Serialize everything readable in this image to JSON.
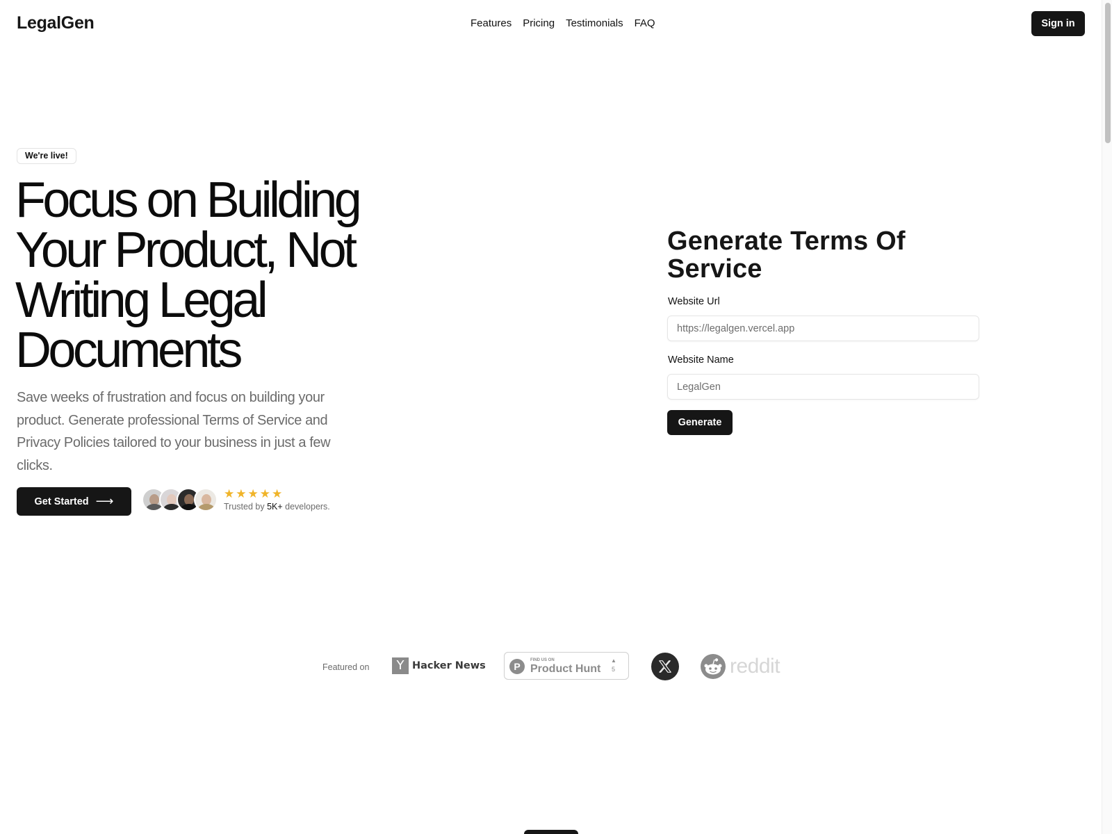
{
  "header": {
    "logo": "LegalGen",
    "nav": [
      {
        "label": "Features"
      },
      {
        "label": "Pricing"
      },
      {
        "label": "Testimonials"
      },
      {
        "label": "FAQ"
      }
    ],
    "sign_in_label": "Sign in"
  },
  "hero": {
    "badge": "We're live!",
    "headline": "Focus on Building Your Product, Not Writing Legal Documents",
    "subheadline": "Save weeks of frustration and focus on building your product. Generate professional Terms of Service and Privacy Policies tailored to your business in just a few clicks.",
    "cta_label": "Get Started",
    "cta_icon": "arrow-right-icon",
    "rating": {
      "stars": 5,
      "max_stars": 5,
      "star_color": "#f0b429"
    },
    "trusted_prefix": "Trusted by",
    "trusted_count": "5K+",
    "trusted_suffix": "developers.",
    "avatar_count": 4
  },
  "form": {
    "title": "Generate Terms Of Service",
    "url_label": "Website Url",
    "url_placeholder": "https://legalgen.vercel.app",
    "url_value": "",
    "name_label": "Website Name",
    "name_placeholder": "LegalGen",
    "name_value": "",
    "submit_label": "Generate"
  },
  "featured": {
    "label": "Featured on",
    "hacker_news": {
      "glyph": "Y",
      "text": "Hacker News"
    },
    "product_hunt": {
      "find_text": "FIND US ON",
      "name": "Product Hunt",
      "upvote_glyph": "▲",
      "upvotes": "5"
    },
    "x_icon": "x-logo-icon",
    "reddit": {
      "word": "reddit"
    }
  },
  "colors": {
    "primary": "#161616",
    "muted_text": "#6b6b6b",
    "star": "#f0b429"
  }
}
